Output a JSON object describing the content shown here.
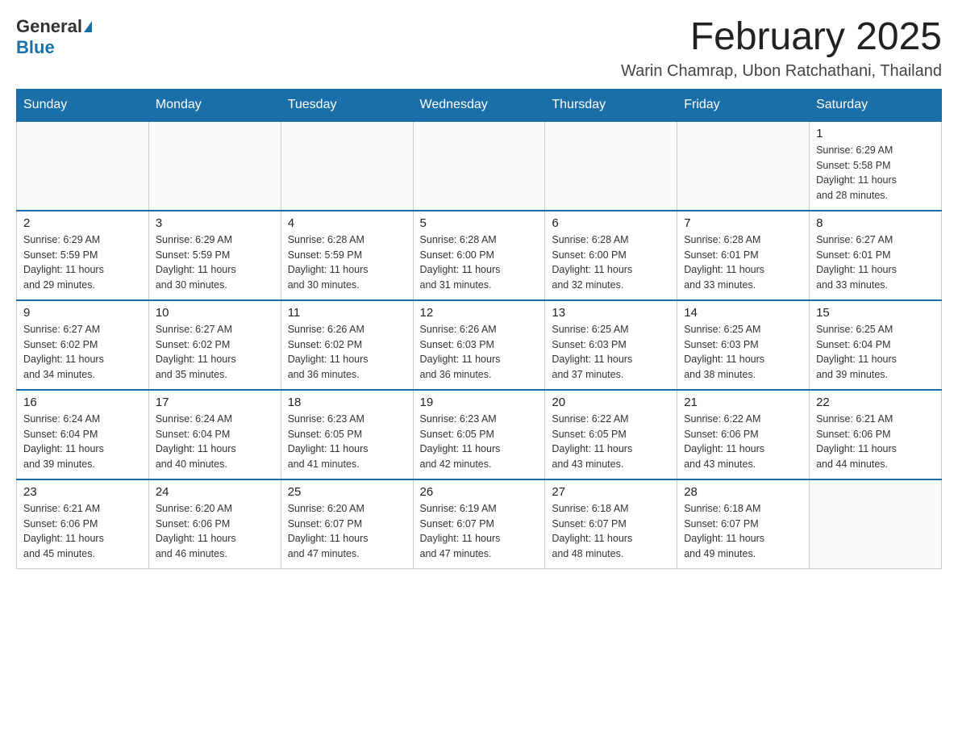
{
  "header": {
    "logo_general": "General",
    "logo_blue": "Blue",
    "month_year": "February 2025",
    "location": "Warin Chamrap, Ubon Ratchathani, Thailand"
  },
  "weekdays": [
    "Sunday",
    "Monday",
    "Tuesday",
    "Wednesday",
    "Thursday",
    "Friday",
    "Saturday"
  ],
  "weeks": [
    [
      {
        "day": "",
        "info": ""
      },
      {
        "day": "",
        "info": ""
      },
      {
        "day": "",
        "info": ""
      },
      {
        "day": "",
        "info": ""
      },
      {
        "day": "",
        "info": ""
      },
      {
        "day": "",
        "info": ""
      },
      {
        "day": "1",
        "info": "Sunrise: 6:29 AM\nSunset: 5:58 PM\nDaylight: 11 hours\nand 28 minutes."
      }
    ],
    [
      {
        "day": "2",
        "info": "Sunrise: 6:29 AM\nSunset: 5:59 PM\nDaylight: 11 hours\nand 29 minutes."
      },
      {
        "day": "3",
        "info": "Sunrise: 6:29 AM\nSunset: 5:59 PM\nDaylight: 11 hours\nand 30 minutes."
      },
      {
        "day": "4",
        "info": "Sunrise: 6:28 AM\nSunset: 5:59 PM\nDaylight: 11 hours\nand 30 minutes."
      },
      {
        "day": "5",
        "info": "Sunrise: 6:28 AM\nSunset: 6:00 PM\nDaylight: 11 hours\nand 31 minutes."
      },
      {
        "day": "6",
        "info": "Sunrise: 6:28 AM\nSunset: 6:00 PM\nDaylight: 11 hours\nand 32 minutes."
      },
      {
        "day": "7",
        "info": "Sunrise: 6:28 AM\nSunset: 6:01 PM\nDaylight: 11 hours\nand 33 minutes."
      },
      {
        "day": "8",
        "info": "Sunrise: 6:27 AM\nSunset: 6:01 PM\nDaylight: 11 hours\nand 33 minutes."
      }
    ],
    [
      {
        "day": "9",
        "info": "Sunrise: 6:27 AM\nSunset: 6:02 PM\nDaylight: 11 hours\nand 34 minutes."
      },
      {
        "day": "10",
        "info": "Sunrise: 6:27 AM\nSunset: 6:02 PM\nDaylight: 11 hours\nand 35 minutes."
      },
      {
        "day": "11",
        "info": "Sunrise: 6:26 AM\nSunset: 6:02 PM\nDaylight: 11 hours\nand 36 minutes."
      },
      {
        "day": "12",
        "info": "Sunrise: 6:26 AM\nSunset: 6:03 PM\nDaylight: 11 hours\nand 36 minutes."
      },
      {
        "day": "13",
        "info": "Sunrise: 6:25 AM\nSunset: 6:03 PM\nDaylight: 11 hours\nand 37 minutes."
      },
      {
        "day": "14",
        "info": "Sunrise: 6:25 AM\nSunset: 6:03 PM\nDaylight: 11 hours\nand 38 minutes."
      },
      {
        "day": "15",
        "info": "Sunrise: 6:25 AM\nSunset: 6:04 PM\nDaylight: 11 hours\nand 39 minutes."
      }
    ],
    [
      {
        "day": "16",
        "info": "Sunrise: 6:24 AM\nSunset: 6:04 PM\nDaylight: 11 hours\nand 39 minutes."
      },
      {
        "day": "17",
        "info": "Sunrise: 6:24 AM\nSunset: 6:04 PM\nDaylight: 11 hours\nand 40 minutes."
      },
      {
        "day": "18",
        "info": "Sunrise: 6:23 AM\nSunset: 6:05 PM\nDaylight: 11 hours\nand 41 minutes."
      },
      {
        "day": "19",
        "info": "Sunrise: 6:23 AM\nSunset: 6:05 PM\nDaylight: 11 hours\nand 42 minutes."
      },
      {
        "day": "20",
        "info": "Sunrise: 6:22 AM\nSunset: 6:05 PM\nDaylight: 11 hours\nand 43 minutes."
      },
      {
        "day": "21",
        "info": "Sunrise: 6:22 AM\nSunset: 6:06 PM\nDaylight: 11 hours\nand 43 minutes."
      },
      {
        "day": "22",
        "info": "Sunrise: 6:21 AM\nSunset: 6:06 PM\nDaylight: 11 hours\nand 44 minutes."
      }
    ],
    [
      {
        "day": "23",
        "info": "Sunrise: 6:21 AM\nSunset: 6:06 PM\nDaylight: 11 hours\nand 45 minutes."
      },
      {
        "day": "24",
        "info": "Sunrise: 6:20 AM\nSunset: 6:06 PM\nDaylight: 11 hours\nand 46 minutes."
      },
      {
        "day": "25",
        "info": "Sunrise: 6:20 AM\nSunset: 6:07 PM\nDaylight: 11 hours\nand 47 minutes."
      },
      {
        "day": "26",
        "info": "Sunrise: 6:19 AM\nSunset: 6:07 PM\nDaylight: 11 hours\nand 47 minutes."
      },
      {
        "day": "27",
        "info": "Sunrise: 6:18 AM\nSunset: 6:07 PM\nDaylight: 11 hours\nand 48 minutes."
      },
      {
        "day": "28",
        "info": "Sunrise: 6:18 AM\nSunset: 6:07 PM\nDaylight: 11 hours\nand 49 minutes."
      },
      {
        "day": "",
        "info": ""
      }
    ]
  ]
}
